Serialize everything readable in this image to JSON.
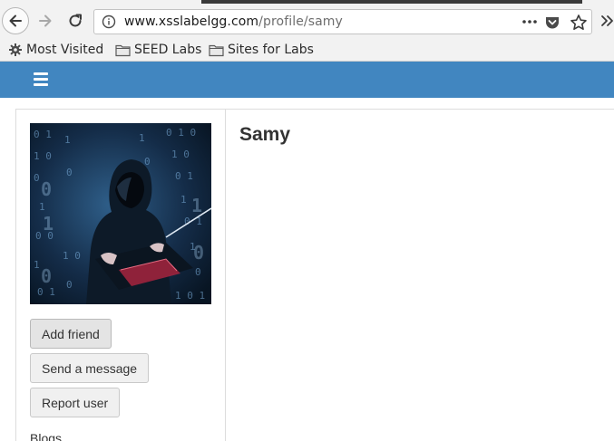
{
  "browser": {
    "url_host": "www.xsslabelgg.com",
    "url_path": "/profile/samy",
    "page_actions_icon": "ellipsis-icon",
    "bookmarks": [
      {
        "label": "Most Visited",
        "icon": "gear-icon"
      },
      {
        "label": "SEED Labs",
        "icon": "folder-icon"
      },
      {
        "label": "Sites for Labs",
        "icon": "folder-icon"
      }
    ]
  },
  "site": {
    "header_color": "#4186c0",
    "menu_icon": "hamburger-menu-icon"
  },
  "profile": {
    "name": "Samy",
    "avatar": "hooded-hacker-with-laptop-binary-code",
    "actions": {
      "add_friend": "Add friend",
      "send_message": "Send a message",
      "report_user": "Report user"
    },
    "links": {
      "blogs": "Blogs"
    }
  }
}
